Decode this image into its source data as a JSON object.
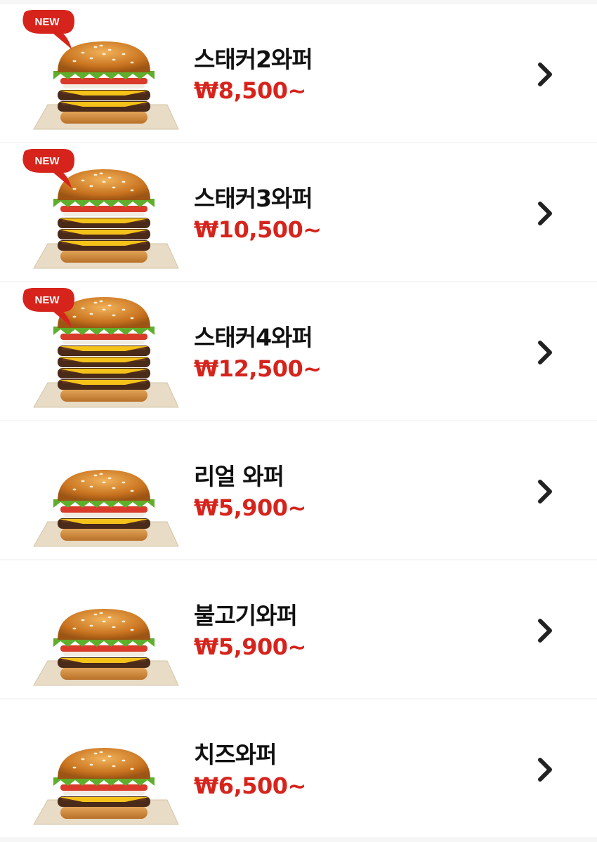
{
  "colors": {
    "price": "#d6241c",
    "badge": "#d6241c",
    "name": "#111111",
    "chevron": "#222222"
  },
  "badge_label": "NEW",
  "chevron_icon": "chevron-right-icon",
  "items": [
    {
      "name": "스태커2와퍼",
      "price": "₩8,500~",
      "is_new": true,
      "patties": 2,
      "image_icon": "burger-icon"
    },
    {
      "name": "스태커3와퍼",
      "price": "₩10,500~",
      "is_new": true,
      "patties": 3,
      "image_icon": "burger-icon"
    },
    {
      "name": "스태커4와퍼",
      "price": "₩12,500~",
      "is_new": true,
      "patties": 4,
      "image_icon": "burger-icon"
    },
    {
      "name": "리얼 와퍼",
      "price": "₩5,900~",
      "is_new": false,
      "patties": 1,
      "image_icon": "burger-icon"
    },
    {
      "name": "불고기와퍼",
      "price": "₩5,900~",
      "is_new": false,
      "patties": 1,
      "image_icon": "burger-icon"
    },
    {
      "name": "치즈와퍼",
      "price": "₩6,500~",
      "is_new": false,
      "patties": 1,
      "image_icon": "burger-icon"
    }
  ]
}
